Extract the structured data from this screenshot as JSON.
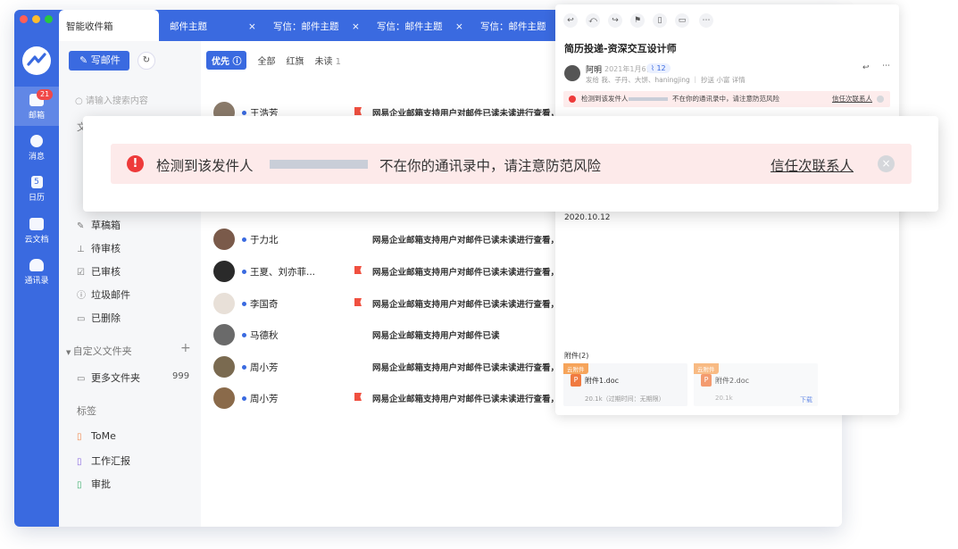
{
  "tabs": [
    "智能收件箱",
    "邮件主题",
    "写信：邮件主题",
    "写信：邮件主题",
    "写信：邮件主题"
  ],
  "rail": {
    "items": [
      {
        "label": "邮箱",
        "badge": "21"
      },
      {
        "label": "消息"
      },
      {
        "label": "日历",
        "day": "5"
      },
      {
        "label": "云文档"
      },
      {
        "label": "通讯录"
      }
    ]
  },
  "folders": {
    "compose_label": "写邮件",
    "search_placeholder": "请输入搜索内容",
    "section_label": "文件夹",
    "items": [
      "草稿箱",
      "待审核",
      "已审核",
      "垃圾邮件",
      "已删除"
    ],
    "custom_title": "自定义文件夹",
    "custom_item": "更多文件夹",
    "custom_count": "999",
    "tags_title": "标签",
    "tags": [
      "ToMe",
      "工作汇报",
      "审批"
    ]
  },
  "list": {
    "filters": {
      "priority": "优先",
      "all": "全部",
      "flag": "红旗",
      "unread": "未读",
      "unread_count": "1"
    },
    "rows": [
      {
        "sender": "王浩芳",
        "subject": "网易企业邮箱支持用户对邮件已读未读进行查看，实时",
        "flag": true
      },
      {
        "sender": "于力北",
        "subject": "网易企业邮箱支持用户对邮件已读未读进行查看，实时",
        "flag": false
      },
      {
        "sender": "王夏、刘亦菲...",
        "subject": "网易企业邮箱支持用户对邮件已读未读进行查看，实时",
        "flag": true
      },
      {
        "sender": "李国奇",
        "subject": "网易企业邮箱支持用户对邮件已读未读进行查看，实时",
        "flag": true
      },
      {
        "sender": "马德秋",
        "subject": "网易企业邮箱支持用户对邮件已读",
        "flag": false
      },
      {
        "sender": "周小芳",
        "subject": "网易企业邮箱支持用户对邮件已读未读进行查看，实时",
        "flag": false
      },
      {
        "sender": "周小芳",
        "subject": "网易企业邮箱支持用户对邮件已读未读进行查看，实时",
        "flag": true
      }
    ]
  },
  "reader": {
    "title": "简历投递-资深交互设计师",
    "from": "阿明",
    "date": "2021年1月6日",
    "tag": "12",
    "to_line": "发给 我、子丹、大饼、haningjing  ｜ 抄送 小富  详情",
    "alert_prefix": "检测到该发件人",
    "alert_suffix": "不在你的通讯录中，请注意防范风险",
    "alert_trust": "信任次联系人",
    "body_date": "2020.10.12",
    "attachments_title": "附件(2)",
    "attachments": [
      {
        "badge": "云附件",
        "name": "附件1.doc",
        "size": "20.1k（过期时间：无期限）",
        "action": ""
      },
      {
        "badge": "云附件",
        "name": "附件2.doc",
        "size": "20.1k",
        "action": "下载"
      }
    ]
  },
  "popup": {
    "prefix": "检测到该发件人",
    "suffix": "不在你的通讯录中，请注意防范风险",
    "trust": "信任次联系人"
  },
  "colors": {
    "brand": "#3a6ae0",
    "alert_bg": "#fdeaea",
    "danger": "#ee3a3a"
  }
}
